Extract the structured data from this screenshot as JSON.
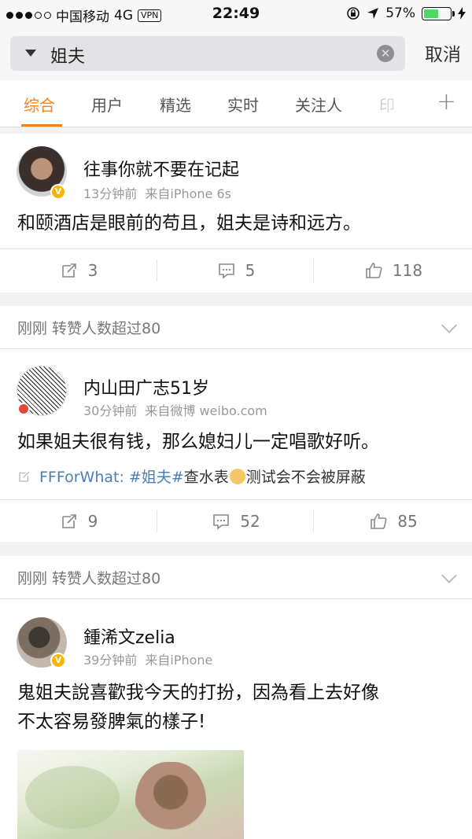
{
  "status_bar": {
    "carrier": "中国移动",
    "network": "4G",
    "vpn": "VPN",
    "time": "22:49",
    "battery": "57%",
    "battery_level": 0.57
  },
  "search": {
    "query": "姐夫",
    "cancel_label": "取消"
  },
  "tabs": [
    {
      "label": "综合",
      "active": true
    },
    {
      "label": "用户"
    },
    {
      "label": "精选"
    },
    {
      "label": "实时"
    },
    {
      "label": "关注人"
    },
    {
      "label": "印"
    }
  ],
  "posts": [
    {
      "username": "往事你就不要在记起",
      "time": "13分钟前",
      "source": "来自iPhone 6s",
      "text": "和颐酒店是眼前的苟且，姐夫是诗和远方。",
      "reposts": "3",
      "comments": "5",
      "likes": "118"
    },
    {
      "notice": "刚刚 转赞人数超过80",
      "username": "内山田广志51岁",
      "time": "30分钟前",
      "source": "来自微博 weibo.com",
      "text": "如果姐夫很有钱，那么媳妇儿一定唱歌好听。",
      "link_author": "FFForWhat:",
      "link_tag": "#姐夫#",
      "link_text_1": "查水表",
      "link_text_2": "测试会不会被屏蔽",
      "reposts": "9",
      "comments": "52",
      "likes": "85"
    },
    {
      "notice": "刚刚 转赞人数超过80",
      "username": "鍾浠文zelia",
      "time": "39分钟前",
      "source": "来自iPhone",
      "text_line1": "鬼姐夫說喜歡我今天的打扮，因為看上去好像",
      "text_line2": "不太容易發脾氣的樣子!"
    }
  ]
}
